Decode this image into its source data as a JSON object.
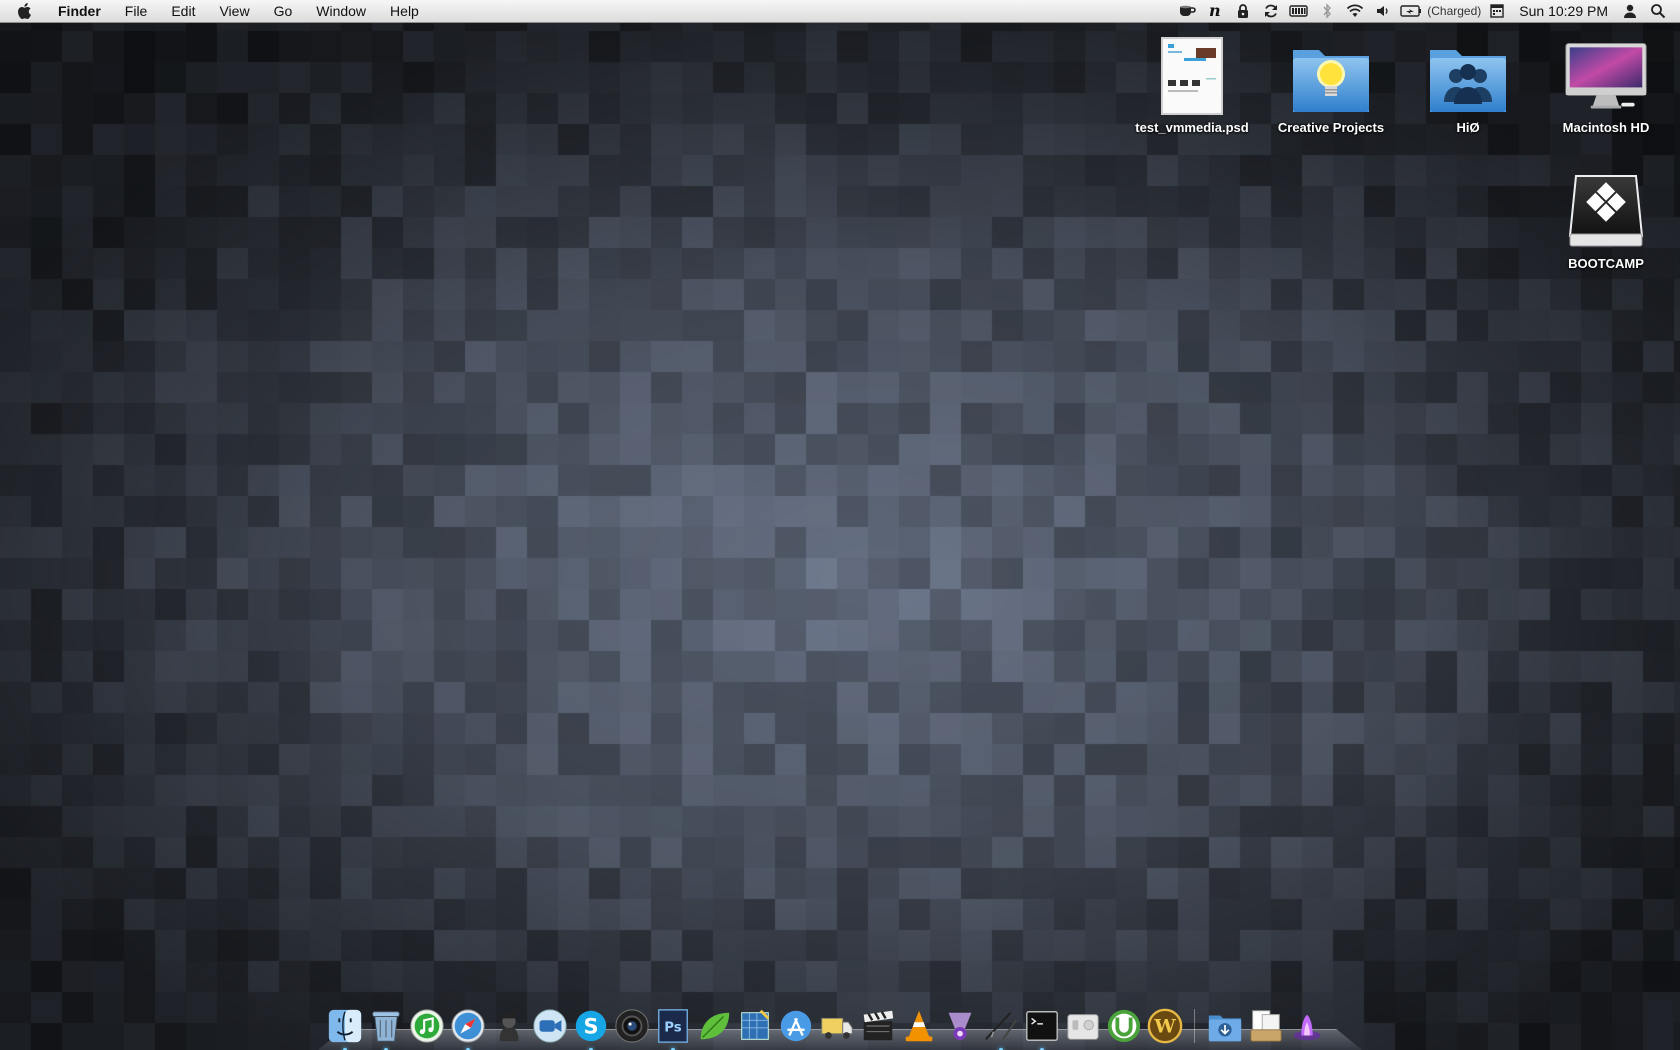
{
  "menubar": {
    "app_name": "Finder",
    "menus": [
      "File",
      "Edit",
      "View",
      "Go",
      "Window",
      "Help"
    ],
    "status_icons": [
      "coffee-cup-icon",
      "n-script-icon",
      "lock-icon",
      "sync-icon",
      "battery-meter-icon",
      "bluetooth-icon",
      "wifi-icon",
      "volume-icon",
      "battery-icon"
    ],
    "battery_status": "(Charged)",
    "clock": "Sun 10:29 PM"
  },
  "desktop": {
    "icons": [
      {
        "label": "test_vmmedia.psd",
        "icon": "psd-document-icon"
      },
      {
        "label": "Creative Projects",
        "icon": "lightbulb-folder-icon"
      },
      {
        "label": "HiØ",
        "icon": "group-folder-icon"
      },
      {
        "label": "Macintosh HD",
        "icon": "imac-drive-icon"
      },
      {
        "label": "BOOTCAMP",
        "icon": "bootcamp-drive-icon"
      }
    ]
  },
  "dock": {
    "apps": [
      {
        "name": "Finder",
        "icon": "finder-icon",
        "running": true
      },
      {
        "name": "Trash",
        "icon": "trash-icon",
        "running": true
      },
      {
        "name": "iTunes",
        "icon": "itunes-icon",
        "running": false
      },
      {
        "name": "Safari",
        "icon": "safari-icon",
        "running": true
      },
      {
        "name": "Agent",
        "icon": "agent-icon",
        "running": false
      },
      {
        "name": "FaceTime",
        "icon": "facetime-icon",
        "running": false
      },
      {
        "name": "Skype",
        "icon": "skype-icon",
        "running": true
      },
      {
        "name": "Camera",
        "icon": "camera-icon",
        "running": false
      },
      {
        "name": "Photoshop",
        "icon": "photoshop-icon",
        "running": true
      },
      {
        "name": "Leaf",
        "icon": "leaf-icon",
        "running": false
      },
      {
        "name": "Blueprint",
        "icon": "blueprint-icon",
        "running": false
      },
      {
        "name": "App Store",
        "icon": "app-store-icon",
        "running": false
      },
      {
        "name": "Transmit",
        "icon": "truck-icon",
        "running": false
      },
      {
        "name": "iMovie",
        "icon": "clapperboard-icon",
        "running": false
      },
      {
        "name": "VLC",
        "icon": "vlc-cone-icon",
        "running": false
      },
      {
        "name": "Spotlight",
        "icon": "spotlight-icon",
        "running": false
      },
      {
        "name": "Pen",
        "icon": "pen-icon",
        "running": true
      },
      {
        "name": "Terminal",
        "icon": "terminal-icon",
        "running": true
      },
      {
        "name": "Disk",
        "icon": "disk-icon",
        "running": false
      },
      {
        "name": "uTorrent",
        "icon": "utorrent-icon",
        "running": false
      },
      {
        "name": "World of Warcraft",
        "icon": "warcraft-icon",
        "running": false
      }
    ],
    "stacks": [
      {
        "name": "Downloads",
        "icon": "downloads-folder-icon"
      },
      {
        "name": "Documents",
        "icon": "documents-stack-icon"
      },
      {
        "name": "Space",
        "icon": "space-icon"
      }
    ]
  },
  "colors": {
    "wallpaper_base": "#4c5666",
    "menubar": "#e8e8e8",
    "label_text": "#ffffff"
  }
}
